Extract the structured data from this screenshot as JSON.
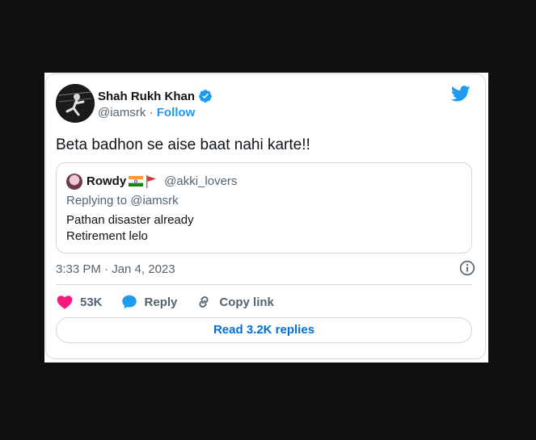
{
  "author": {
    "name": "Shah Rukh Khan",
    "handle": "@iamsrk",
    "separator": "·",
    "follow_label": "Follow",
    "verified": true
  },
  "tweet": {
    "text": "Beta badhon se aise baat nahi karte!!",
    "timestamp": "3:33 PM · Jan 4, 2023"
  },
  "quoted_tweet": {
    "name": "Rowdy",
    "handle": "@akki_lovers",
    "replying_to": "Replying to @iamsrk",
    "lines": [
      "Pathan disaster already",
      "Retirement lelo"
    ]
  },
  "actions": {
    "like_count": "53K",
    "reply_label": "Reply",
    "copy_link_label": "Copy link",
    "read_replies_label": "Read 3.2K replies"
  },
  "colors": {
    "background": "#101010",
    "twitter_blue": "#1d9bf0",
    "like_pink": "#f91880",
    "link_blue": "#006fd6"
  },
  "icons": [
    "twitter-bird-icon",
    "verified-badge-icon",
    "info-icon",
    "heart-icon",
    "reply-bubble-icon",
    "link-icon",
    "india-flag-icon",
    "red-flag-icon"
  ]
}
